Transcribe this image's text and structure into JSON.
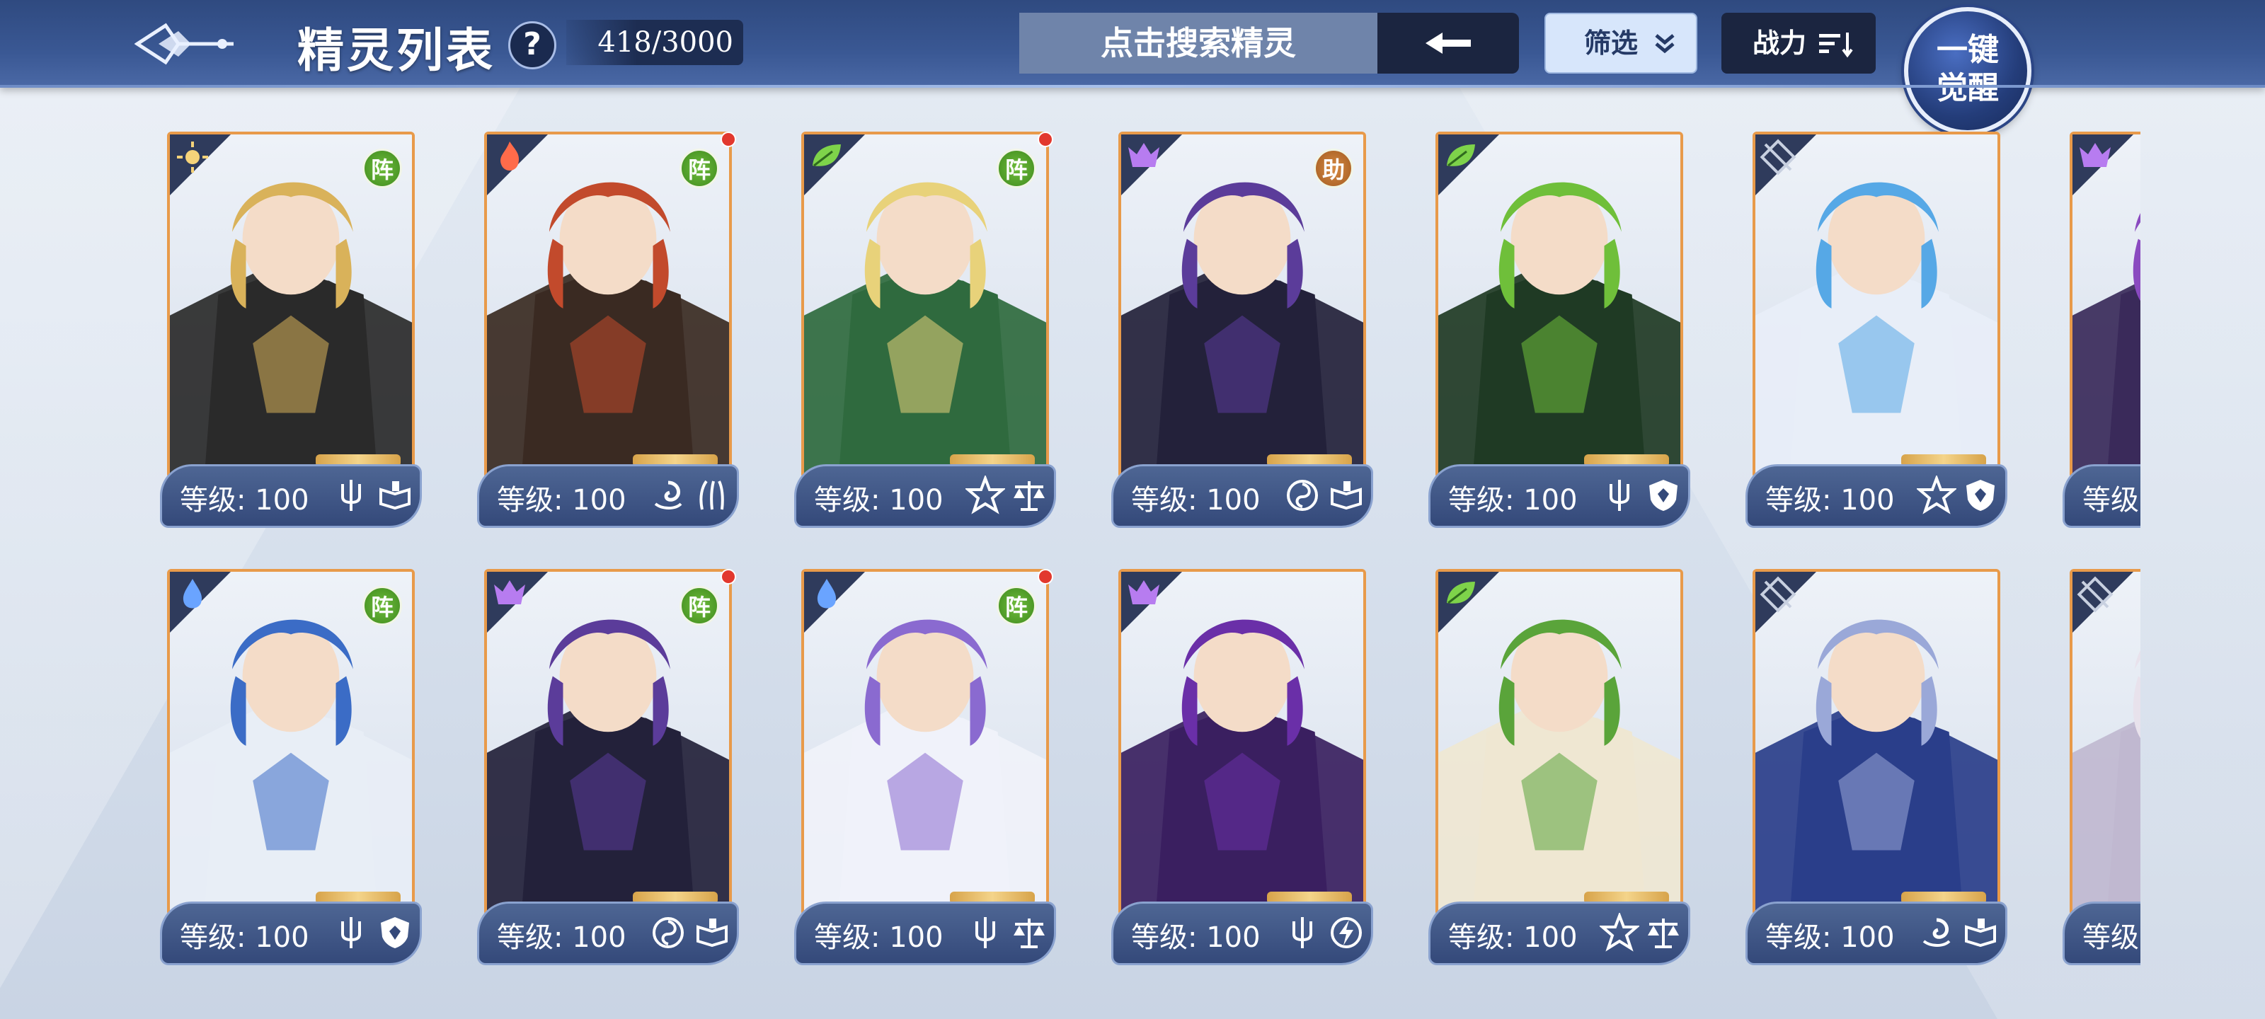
{
  "header": {
    "title": "精灵列表",
    "help": "?",
    "count": "418/3000",
    "search_placeholder": "点击搜索精灵",
    "filter_label": "筛选",
    "power_label": "战力",
    "awaken_line1": "一键",
    "awaken_line2": "觉醒"
  },
  "colors": {
    "topbar": "#3a5894",
    "card_border": "#e89a4a",
    "badge_formation": "#4f9c27",
    "badge_assist": "#b86d2c",
    "notify_dot": "#e2382e"
  },
  "cards": [
    {
      "level": "等级: 100",
      "element": "light-icon",
      "badge": "阵",
      "badge_type": "zhen",
      "dot": false,
      "art": "#d9b25a",
      "art2": "#2a2a2a",
      "icons": [
        "fork-icon",
        "book-icon"
      ]
    },
    {
      "level": "等级: 100",
      "element": "fire-icon",
      "badge": "阵",
      "badge_type": "zhen",
      "dot": true,
      "art": "#c24a2c",
      "art2": "#3a2a22",
      "icons": [
        "swirl-icon",
        "claw-icon"
      ]
    },
    {
      "level": "等级: 100",
      "element": "grass-icon",
      "badge": "阵",
      "badge_type": "zhen",
      "dot": true,
      "art": "#e8d27a",
      "art2": "#2f6a3e",
      "icons": [
        "star-icon",
        "scale-icon"
      ]
    },
    {
      "level": "等级: 100",
      "element": "dark-icon",
      "badge": "助",
      "badge_type": "zhu",
      "dot": false,
      "art": "#5b3c9a",
      "art2": "#23213a",
      "icons": [
        "vortex-icon",
        "book-icon"
      ]
    },
    {
      "level": "等级: 100",
      "element": "grass-icon",
      "badge": "",
      "badge_type": "",
      "dot": false,
      "art": "#6fbf3a",
      "art2": "#1f3a24",
      "icons": [
        "fork-icon",
        "shield-icon"
      ]
    },
    {
      "level": "等级: 100",
      "element": "neutral-icon",
      "badge": "",
      "badge_type": "",
      "dot": false,
      "art": "#56a8e6",
      "art2": "#e8eef8",
      "icons": [
        "star-icon",
        "shield-icon"
      ]
    },
    {
      "level": "等级",
      "element": "dark-icon",
      "badge": "",
      "badge_type": "",
      "dot": false,
      "art": "#8a4ac0",
      "art2": "#3a2a5a",
      "icons": []
    },
    {
      "level": "等级: 100",
      "element": "water-icon",
      "badge": "阵",
      "badge_type": "zhen",
      "dot": false,
      "art": "#3b6cc6",
      "art2": "#e8eef6",
      "icons": [
        "fork-icon",
        "shield-icon"
      ]
    },
    {
      "level": "等级: 100",
      "element": "dark-icon",
      "badge": "阵",
      "badge_type": "zhen",
      "dot": true,
      "art": "#5b3c9a",
      "art2": "#23213a",
      "icons": [
        "vortex-icon",
        "book-icon"
      ]
    },
    {
      "level": "等级: 100",
      "element": "water-icon",
      "badge": "阵",
      "badge_type": "zhen",
      "dot": true,
      "art": "#8a6ad0",
      "art2": "#f0f2fa",
      "icons": [
        "fork-icon",
        "scale-icon"
      ]
    },
    {
      "level": "等级: 100",
      "element": "dark-icon",
      "badge": "",
      "badge_type": "",
      "dot": false,
      "art": "#6a2fa8",
      "art2": "#3a1f60",
      "icons": [
        "fork-icon",
        "bolt-icon"
      ]
    },
    {
      "level": "等级: 100",
      "element": "grass-icon",
      "badge": "",
      "badge_type": "",
      "dot": false,
      "art": "#5aa43a",
      "art2": "#efe7d2",
      "icons": [
        "star-icon",
        "scale-icon"
      ]
    },
    {
      "level": "等级: 100",
      "element": "neutral-icon",
      "badge": "",
      "badge_type": "",
      "dot": false,
      "art": "#9aa8d8",
      "art2": "#2a3e8a",
      "icons": [
        "swirl-icon",
        "book-icon"
      ]
    },
    {
      "level": "等级",
      "element": "neutral-icon",
      "badge": "",
      "badge_type": "",
      "dot": false,
      "art": "#e8e2ec",
      "art2": "#c0b8d0",
      "icons": []
    }
  ]
}
